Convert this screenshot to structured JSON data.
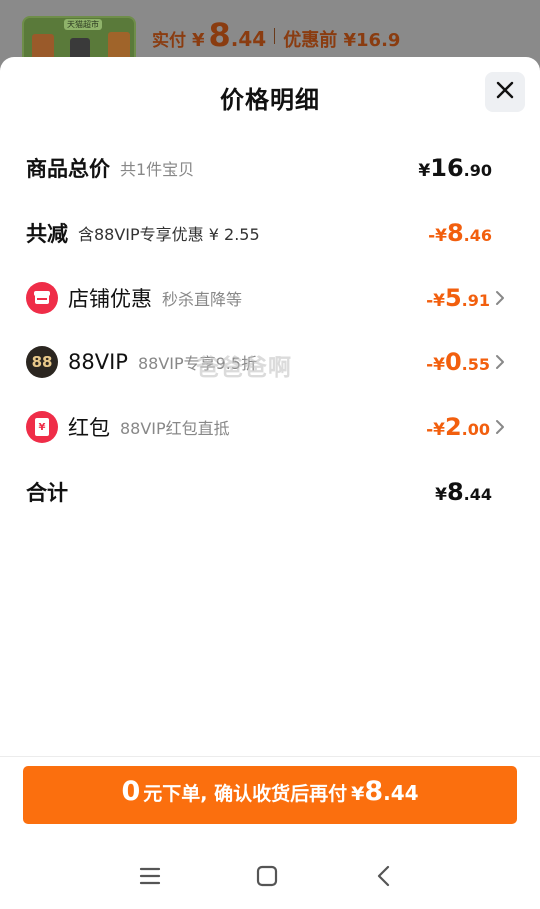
{
  "background": {
    "thumbnail_label": "天猫超市",
    "paid_label": "实付",
    "paid_currency": "¥",
    "paid_int": "8",
    "paid_dec": ".44",
    "before_label": "优惠前 ¥16.9"
  },
  "sheet": {
    "title": "价格明细"
  },
  "rows": [
    {
      "name": "商品总价",
      "sub": "共1件宝贝",
      "amount_yen": "¥",
      "amount_int": "16",
      "amount_dec": ".90"
    },
    {
      "name": "共减",
      "sub": "含88VIP专享优惠 ¥ 2.55",
      "amount_yen": "-¥",
      "amount_int": "8",
      "amount_dec": ".46"
    },
    {
      "name": "店铺优惠",
      "sub": "秒杀直降等",
      "amount_yen": "-¥",
      "amount_int": "5",
      "amount_dec": ".91",
      "icon": "shop-icon"
    },
    {
      "name": "88VIP",
      "sub": "88VIP专享9.5折",
      "amount_yen": "-¥",
      "amount_int": "0",
      "amount_dec": ".55",
      "icon": "88vip-icon",
      "icon_text": "88"
    },
    {
      "name": "红包",
      "sub": "88VIP红包直抵",
      "amount_yen": "-¥",
      "amount_int": "2",
      "amount_dec": ".00",
      "icon": "red-packet-icon",
      "icon_text": "¥"
    },
    {
      "name": "合计",
      "amount_yen": "¥",
      "amount_int": "8",
      "amount_dec": ".44"
    }
  ],
  "watermark": "爸爸爸啊",
  "cta": {
    "zero": "0",
    "text": "元下单, 确认收货后再付",
    "yen": "¥",
    "int": "8",
    "dec": ".44"
  },
  "colors": {
    "accent": "#fb6f0e",
    "discount": "#f25f0e",
    "shop_icon": "#ef2d48",
    "vip_icon": "#2b2620",
    "red_packet_icon": "#ef2d48"
  },
  "nav": {
    "icons": [
      "menu-icon",
      "home-icon",
      "back-icon"
    ]
  }
}
